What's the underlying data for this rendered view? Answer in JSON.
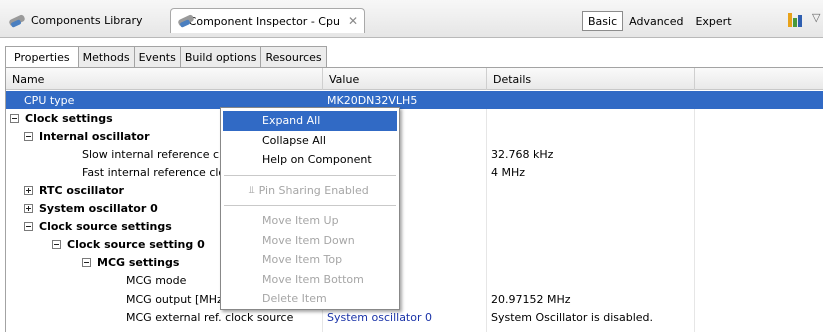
{
  "view_tabs": [
    {
      "label": "Components Library"
    },
    {
      "label": "Component Inspector - Cpu",
      "close": "✕"
    }
  ],
  "modes": [
    "Basic",
    "Advanced",
    "Expert"
  ],
  "active_mode": "Basic",
  "view_menu_glyph": "▽",
  "sub_tabs": [
    "Properties",
    "Methods",
    "Events",
    "Build options",
    "Resources"
  ],
  "active_sub_tab": "Properties",
  "columns": {
    "name": "Name",
    "value": "Value",
    "details": "Details"
  },
  "rows": [
    {
      "name": "CPU type",
      "value": "MK20DN32VLH5",
      "details": "",
      "indent": 18,
      "toggle": "",
      "bold": false,
      "selected": true
    },
    {
      "name": "Clock settings",
      "value": "",
      "details": "",
      "indent": 4,
      "toggle": "minus",
      "bold": true
    },
    {
      "name": "Internal oscillator",
      "value": "",
      "details": "",
      "indent": 18,
      "toggle": "minus",
      "bold": true
    },
    {
      "name": "Slow internal reference cl",
      "value": "",
      "details": "32.768 kHz",
      "indent": 76,
      "toggle": "",
      "bold": false
    },
    {
      "name": "Fast internal reference clo",
      "value": "",
      "details": "4 MHz",
      "indent": 76,
      "toggle": "",
      "bold": false
    },
    {
      "name": "RTC oscillator",
      "value": "",
      "details": "",
      "indent": 18,
      "toggle": "plus",
      "bold": true
    },
    {
      "name": "System oscillator 0",
      "value": "",
      "details": "",
      "indent": 18,
      "toggle": "plus",
      "bold": true
    },
    {
      "name": "Clock source settings",
      "value": "",
      "details": "",
      "indent": 18,
      "toggle": "minus",
      "bold": true
    },
    {
      "name": "Clock source setting 0",
      "value": "",
      "details": "",
      "indent": 46,
      "toggle": "minus",
      "bold": true
    },
    {
      "name": "MCG settings",
      "value": "",
      "details": "",
      "indent": 76,
      "toggle": "minus",
      "bold": true
    },
    {
      "name": "MCG mode",
      "value": "",
      "details": "",
      "indent": 120,
      "toggle": "",
      "bold": false
    },
    {
      "name": "MCG output [MHz",
      "value": "",
      "details": "20.97152 MHz",
      "indent": 120,
      "toggle": "",
      "bold": false
    },
    {
      "name": "MCG external ref. clock source",
      "value": "System oscillator 0",
      "details": "System Oscillator is disabled.",
      "indent": 120,
      "toggle": "",
      "bold": false,
      "value_link": true
    }
  ],
  "context_menu": {
    "group1": [
      {
        "label": "Expand All",
        "state": "highlighted"
      },
      {
        "label": "Collapse All",
        "state": "enabled"
      },
      {
        "label": "Help on Component",
        "state": "enabled"
      }
    ],
    "group2": [
      {
        "label": "Pin Sharing Enabled",
        "state": "disabled",
        "icon": "pin-icon"
      }
    ],
    "group3": [
      {
        "label": "Move Item Up",
        "state": "disabled"
      },
      {
        "label": "Move Item Down",
        "state": "disabled"
      },
      {
        "label": "Move Item Top",
        "state": "disabled"
      },
      {
        "label": "Move Item Bottom",
        "state": "disabled"
      },
      {
        "label": "Delete Item",
        "state": "disabled"
      }
    ]
  },
  "colors": {
    "selection": "#316ac5",
    "link": "#1a33a8",
    "disabled_text": "#a6a6a6"
  }
}
